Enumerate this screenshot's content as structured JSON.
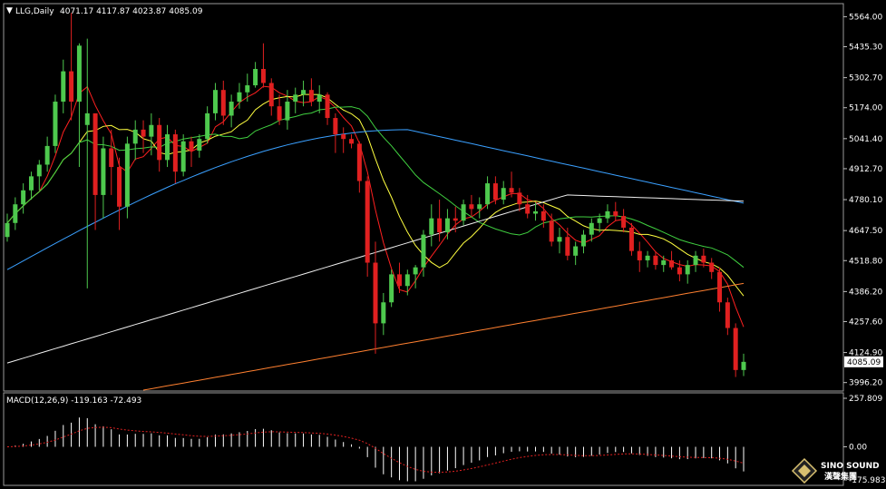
{
  "header": {
    "symbol": "LLG,Daily",
    "ohlc": "4071.17 4117.87 4023.87 4085.09"
  },
  "macd": {
    "label": "MACD(12,26,9) -119.163 -72.493",
    "ticks": [
      "257.809",
      "0.00",
      "-175.983"
    ]
  },
  "logo": {
    "name": "SINO SOUND",
    "subtitle": "漢聲集團"
  },
  "colors": {
    "background": "#000000",
    "up": "#4ec94e",
    "down": "#e02020",
    "ma5": "#ff2020",
    "ma10": "#ffff40",
    "ma20": "#40d040",
    "ma60": "#3aa0ff",
    "ma120": "#f0f0f0",
    "ma250": "#ff8030",
    "macd_hist": "#ffffff",
    "macd_signal": "#e02020",
    "axis": "#c0c0c0"
  },
  "chart_data": {
    "type": "candlestick",
    "timeframe": "Daily",
    "ylim": [
      3960,
      5620
    ],
    "yticks": [
      "5564.00",
      "5435.30",
      "5302.70",
      "5174.00",
      "5041.40",
      "4912.70",
      "4780.10",
      "4647.50",
      "4518.80",
      "4386.20",
      "4257.60",
      "4124.90",
      "3996.20"
    ],
    "last_price": "4085.09",
    "ohlc": [
      [
        4620,
        4720,
        4600,
        4680
      ],
      [
        4680,
        4790,
        4650,
        4760
      ],
      [
        4760,
        4850,
        4720,
        4820
      ],
      [
        4820,
        4900,
        4780,
        4880
      ],
      [
        4880,
        4950,
        4820,
        4930
      ],
      [
        4930,
        5050,
        4900,
        5010
      ],
      [
        5010,
        5230,
        4980,
        5200
      ],
      [
        5200,
        5380,
        5150,
        5330
      ],
      [
        5330,
        5580,
        5120,
        5200
      ],
      [
        5200,
        5450,
        4920,
        5440
      ],
      [
        5100,
        5470,
        4400,
        5150
      ],
      [
        5150,
        5100,
        4650,
        4800
      ],
      [
        4800,
        5050,
        4700,
        5000
      ],
      [
        5000,
        5080,
        4800,
        4920
      ],
      [
        4920,
        4960,
        4650,
        4750
      ],
      [
        4750,
        5050,
        4700,
        5020
      ],
      [
        5020,
        5120,
        4950,
        5080
      ],
      [
        5080,
        5120,
        4980,
        5050
      ],
      [
        5050,
        5150,
        4970,
        5100
      ],
      [
        5100,
        5130,
        4900,
        4950
      ],
      [
        4950,
        5100,
        4920,
        5060
      ],
      [
        5060,
        5080,
        4850,
        4900
      ],
      [
        4900,
        5060,
        4880,
        5030
      ],
      [
        5030,
        5050,
        4920,
        4990
      ],
      [
        4990,
        5060,
        4960,
        5040
      ],
      [
        5040,
        5180,
        5020,
        5150
      ],
      [
        5150,
        5280,
        5120,
        5250
      ],
      [
        5250,
        5290,
        5100,
        5140
      ],
      [
        5140,
        5230,
        5090,
        5200
      ],
      [
        5200,
        5280,
        5170,
        5240
      ],
      [
        5240,
        5320,
        5200,
        5270
      ],
      [
        5270,
        5370,
        5260,
        5340
      ],
      [
        5340,
        5450,
        5260,
        5280
      ],
      [
        5280,
        5300,
        5140,
        5180
      ],
      [
        5180,
        5230,
        5100,
        5120
      ],
      [
        5120,
        5250,
        5080,
        5200
      ],
      [
        5200,
        5260,
        5150,
        5230
      ],
      [
        5230,
        5290,
        5180,
        5250
      ],
      [
        5250,
        5300,
        5180,
        5200
      ],
      [
        5200,
        5270,
        5150,
        5230
      ],
      [
        5230,
        5240,
        5100,
        5130
      ],
      [
        5130,
        5150,
        4980,
        5060
      ],
      [
        5060,
        5090,
        4980,
        5040
      ],
      [
        5040,
        5060,
        5000,
        5020
      ],
      [
        5020,
        5030,
        4810,
        4860
      ],
      [
        4860,
        4880,
        4450,
        4510
      ],
      [
        4510,
        4600,
        4120,
        4250
      ],
      [
        4250,
        4380,
        4200,
        4340
      ],
      [
        4340,
        4480,
        4320,
        4460
      ],
      [
        4460,
        4510,
        4380,
        4410
      ],
      [
        4410,
        4480,
        4370,
        4460
      ],
      [
        4460,
        4500,
        4400,
        4490
      ],
      [
        4490,
        4650,
        4450,
        4630
      ],
      [
        4630,
        4760,
        4580,
        4700
      ],
      [
        4700,
        4780,
        4600,
        4640
      ],
      [
        4640,
        4740,
        4610,
        4700
      ],
      [
        4700,
        4750,
        4640,
        4690
      ],
      [
        4690,
        4780,
        4670,
        4760
      ],
      [
        4760,
        4800,
        4710,
        4740
      ],
      [
        4740,
        4790,
        4700,
        4760
      ],
      [
        4760,
        4880,
        4740,
        4850
      ],
      [
        4850,
        4880,
        4760,
        4780
      ],
      [
        4780,
        4860,
        4760,
        4830
      ],
      [
        4830,
        4900,
        4790,
        4810
      ],
      [
        4810,
        4830,
        4730,
        4760
      ],
      [
        4760,
        4800,
        4700,
        4720
      ],
      [
        4720,
        4770,
        4690,
        4730
      ],
      [
        4730,
        4760,
        4660,
        4690
      ],
      [
        4690,
        4720,
        4580,
        4600
      ],
      [
        4600,
        4660,
        4550,
        4620
      ],
      [
        4620,
        4660,
        4520,
        4540
      ],
      [
        4540,
        4600,
        4500,
        4580
      ],
      [
        4580,
        4650,
        4550,
        4630
      ],
      [
        4630,
        4700,
        4600,
        4680
      ],
      [
        4680,
        4720,
        4640,
        4700
      ],
      [
        4700,
        4760,
        4680,
        4730
      ],
      [
        4730,
        4770,
        4690,
        4710
      ],
      [
        4710,
        4740,
        4640,
        4660
      ],
      [
        4660,
        4680,
        4540,
        4560
      ],
      [
        4560,
        4600,
        4470,
        4520
      ],
      [
        4520,
        4560,
        4490,
        4540
      ],
      [
        4540,
        4560,
        4480,
        4500
      ],
      [
        4500,
        4540,
        4470,
        4520
      ],
      [
        4520,
        4560,
        4480,
        4490
      ],
      [
        4490,
        4520,
        4430,
        4460
      ],
      [
        4460,
        4520,
        4420,
        4500
      ],
      [
        4500,
        4560,
        4470,
        4540
      ],
      [
        4540,
        4570,
        4490,
        4510
      ],
      [
        4510,
        4530,
        4440,
        4470
      ],
      [
        4470,
        4490,
        4300,
        4340
      ],
      [
        4340,
        4360,
        4200,
        4230
      ],
      [
        4230,
        4250,
        4020,
        4050
      ],
      [
        4050,
        4120,
        4024,
        4085
      ]
    ],
    "macd_hist_range": [
      -175.983,
      257.809
    ]
  }
}
